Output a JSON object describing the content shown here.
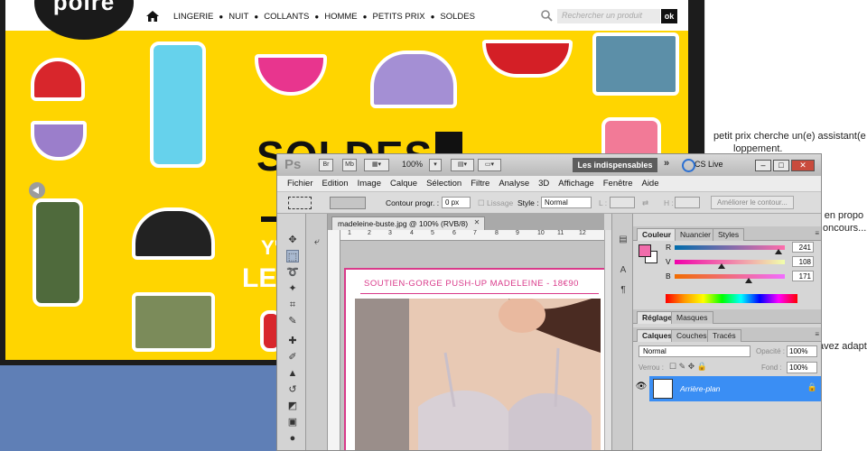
{
  "background_doc": {
    "lines": [
      "petit prix cherche un(e) assistant(e",
      "loppement.",
      ") en propo",
      "oncours...",
      "avez adapt"
    ]
  },
  "browser": {
    "site": {
      "logo_text": "poire",
      "nav": [
        "LINGERIE",
        "NUIT",
        "COLLANTS",
        "HOMME",
        "PETITS PRIX",
        "SOLDES"
      ],
      "search_placeholder": "Rechercher un produit",
      "search_button": "ok",
      "banner": {
        "headline": "SOLDES",
        "sub1": "Y'",
        "sub2": "LE"
      }
    }
  },
  "photoshop": {
    "logo": "Ps",
    "toolbar_btns": [
      "Br",
      "Mb"
    ],
    "zoom": "100%",
    "workspace": "Les indispensables",
    "workspace_more": "»",
    "cslive": "CS Live",
    "window_btns": [
      "–",
      "□",
      "✕"
    ],
    "menu": [
      "Fichier",
      "Edition",
      "Image",
      "Calque",
      "Sélection",
      "Filtre",
      "Analyse",
      "3D",
      "Affichage",
      "Fenêtre",
      "Aide"
    ],
    "options": {
      "contour_label": "Contour progr. :",
      "contour_value": "0 px",
      "lissage": "Lissage",
      "style_label": "Style :",
      "style_value": "Normal",
      "l_label": "L :",
      "h_label": "H :",
      "refine": "Améliorer le contour..."
    },
    "document": {
      "tab": "madeleine-buste.jpg @ 100% (RVB/8)",
      "tab_close": "✕",
      "ruler": [
        "1",
        "2",
        "3",
        "4",
        "5",
        "6",
        "7",
        "8",
        "9",
        "10",
        "11",
        "12"
      ],
      "product_title": "SOUTIEN-GORGE PUSH-UP MADELEINE - 18€90"
    },
    "panels": {
      "color_tabs": [
        "Couleur",
        "Nuancier",
        "Styles"
      ],
      "channels": [
        {
          "label": "R",
          "value": "241",
          "fraction": 0.945
        },
        {
          "label": "V",
          "value": "108",
          "fraction": 0.424
        },
        {
          "label": "B",
          "value": "171",
          "fraction": 0.671
        }
      ],
      "fg_color": "#f16cab",
      "adj_tabs": [
        "Réglages",
        "Masques"
      ],
      "layer_tabs": [
        "Calques",
        "Couches",
        "Tracés"
      ],
      "blend_mode": "Normal",
      "opacity_label": "Opacité :",
      "opacity_value": "100%",
      "lock_label": "Verrou :",
      "fill_label": "Fond :",
      "fill_value": "100%",
      "layer_name": "Arrière-plan"
    }
  }
}
